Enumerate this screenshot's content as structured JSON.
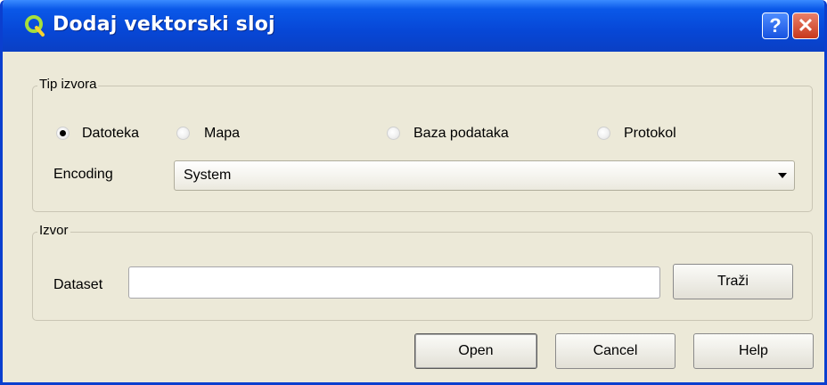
{
  "window": {
    "title": "Dodaj vektorski sloj",
    "help_glyph": "?",
    "close_glyph": "✕",
    "title_bar_color": "#0747d6",
    "app_icon": "qgis-logo-icon"
  },
  "source_type": {
    "group_title": "Tip izvora",
    "options": [
      {
        "label": "Datoteka",
        "selected": true
      },
      {
        "label": "Mapa",
        "selected": false
      },
      {
        "label": "Baza podataka",
        "selected": false
      },
      {
        "label": "Protokol",
        "selected": false
      }
    ],
    "encoding_label": "Encoding",
    "encoding_value": "System"
  },
  "source": {
    "group_title": "Izvor",
    "dataset_label": "Dataset",
    "dataset_value": "",
    "browse_label": "Traži"
  },
  "buttons": {
    "open": "Open",
    "cancel": "Cancel",
    "help": "Help"
  }
}
